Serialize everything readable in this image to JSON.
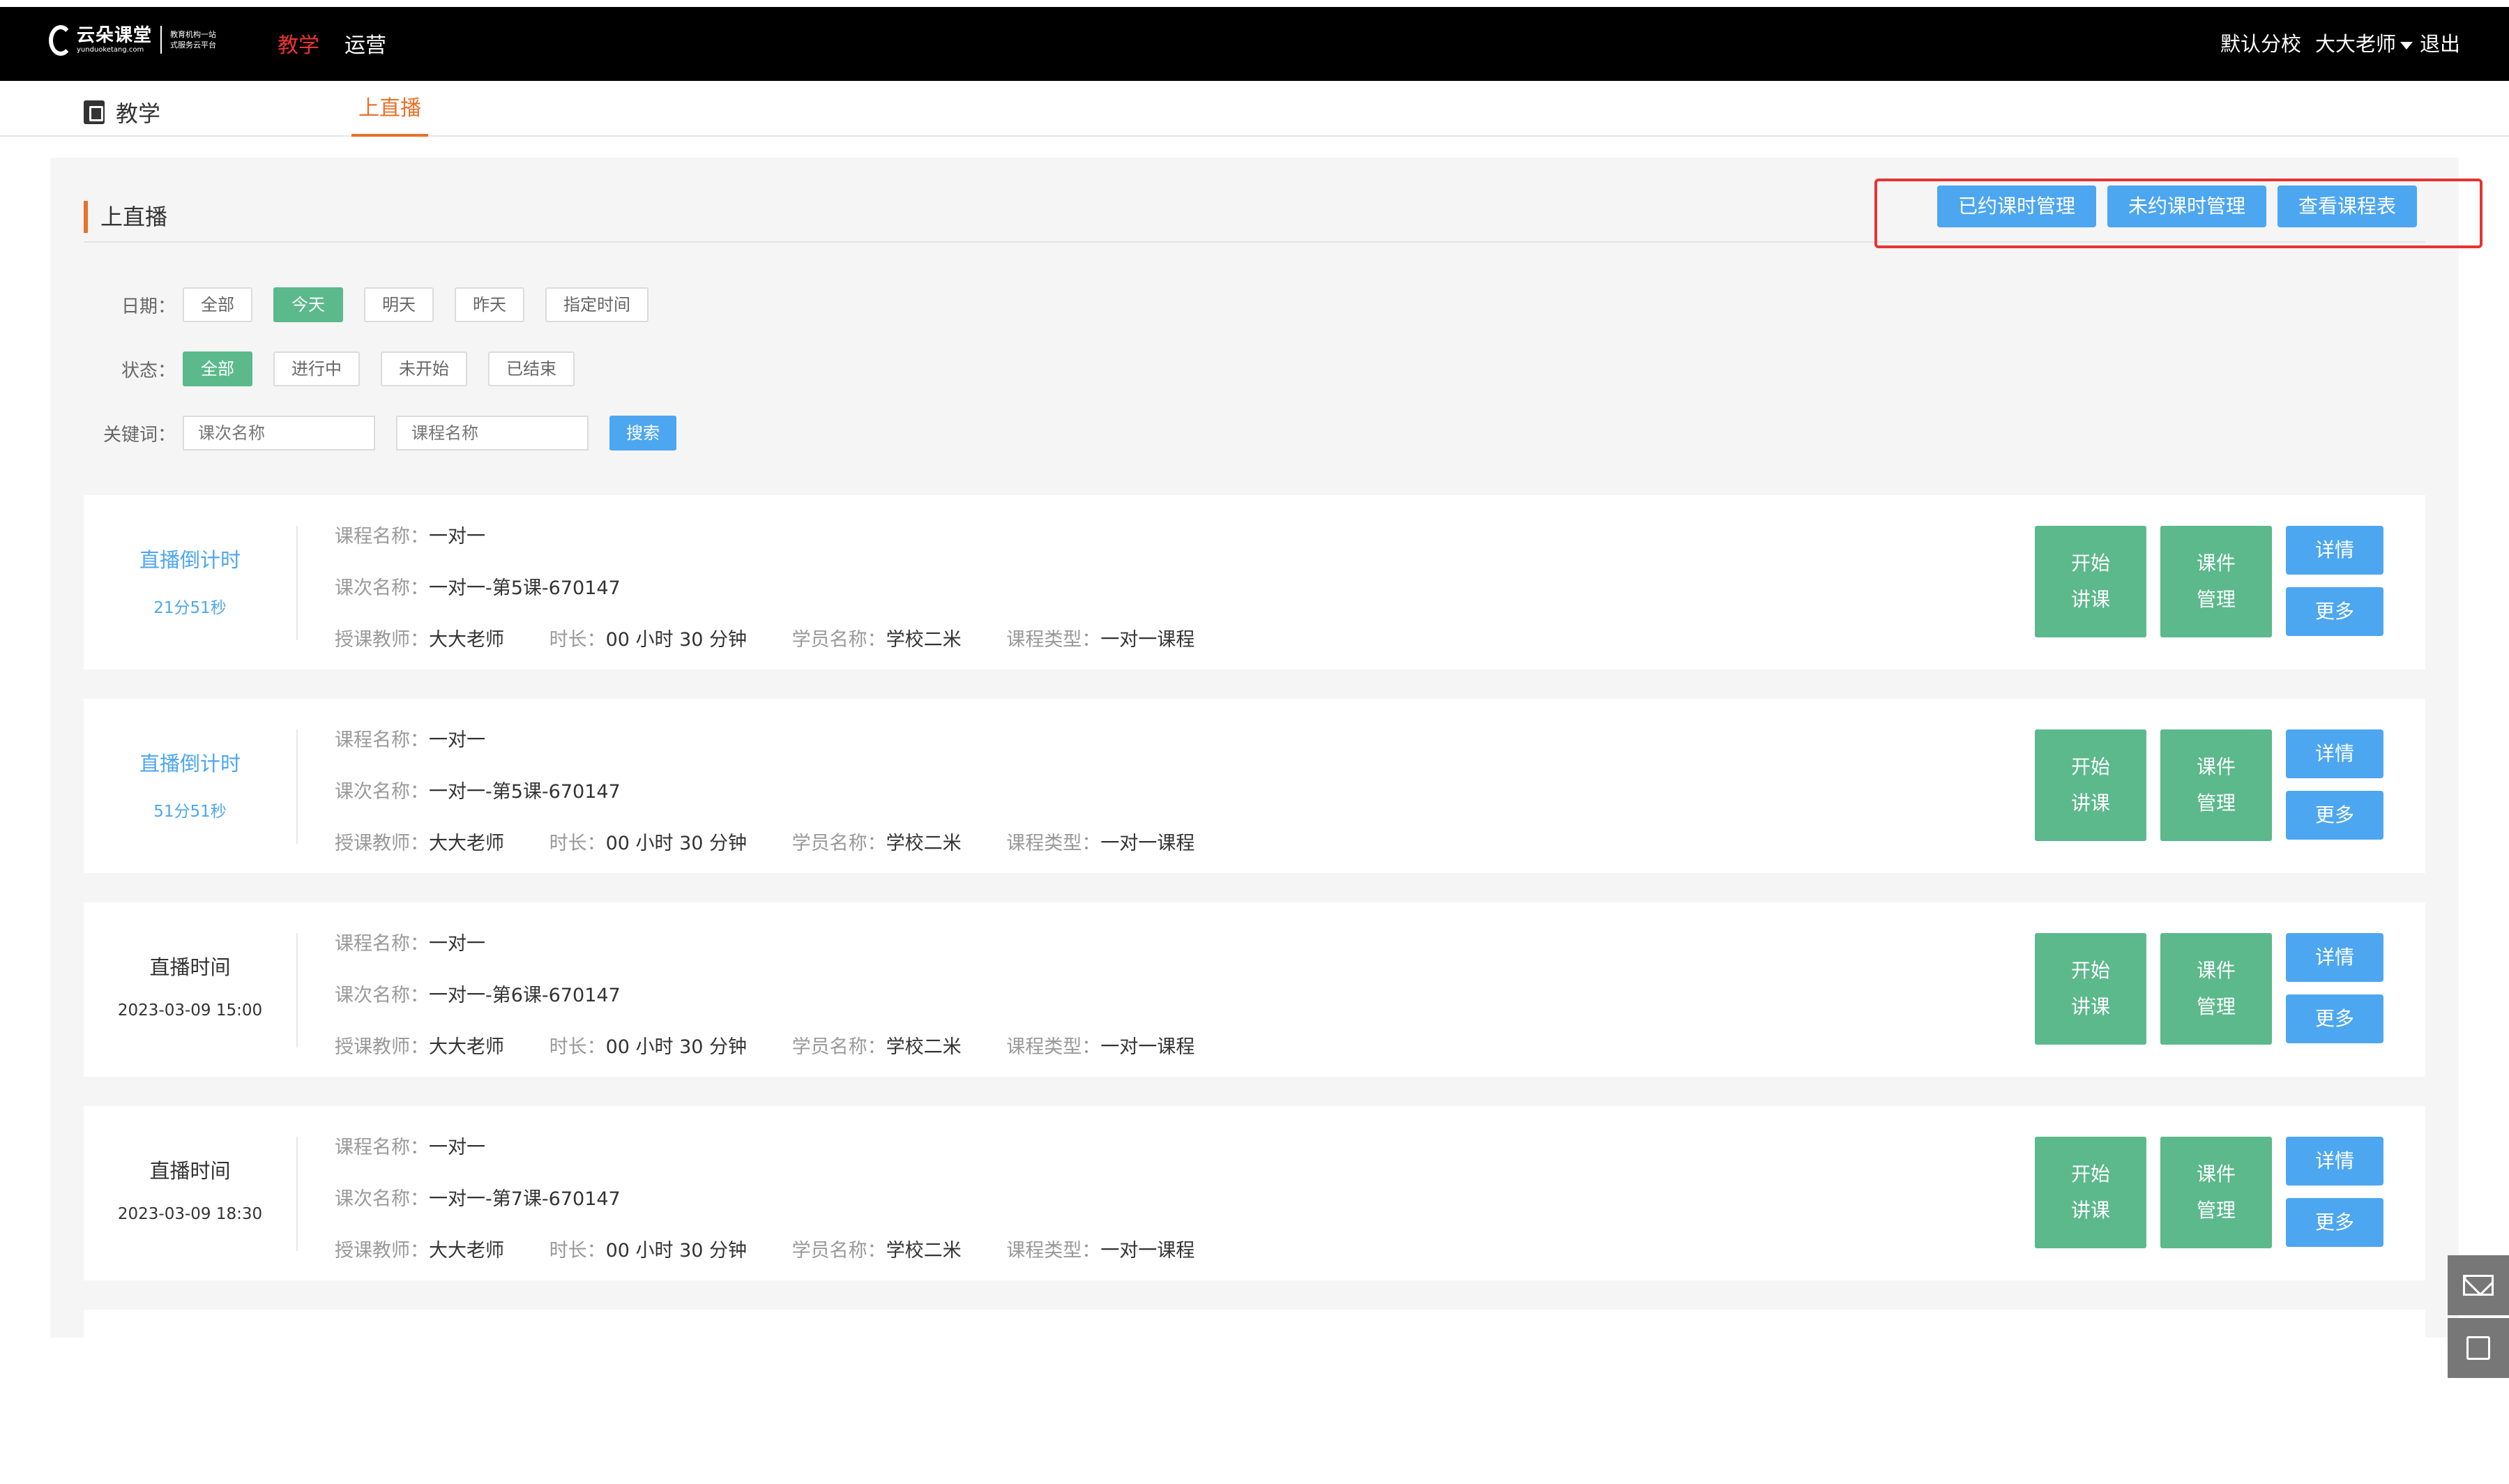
{
  "header": {
    "logo_text": "云朵课堂",
    "logo_en": "yunduoketang.com",
    "logo_slogan_1": "教育机构一站",
    "logo_slogan_2": "式服务云平台",
    "nav": [
      {
        "label": "教学",
        "active": true
      },
      {
        "label": "运营",
        "active": false
      }
    ],
    "branch": "默认分校",
    "user": "大大老师",
    "logout": "退出"
  },
  "subnav": {
    "brand": "教学",
    "tab": "上直播"
  },
  "section": {
    "title": "上直播",
    "actions": [
      "已约课时管理",
      "未约课时管理",
      "查看课程表"
    ]
  },
  "filters": {
    "date_label": "日期：",
    "date_options": [
      "全部",
      "今天",
      "明天",
      "昨天",
      "指定时间"
    ],
    "date_selected": "今天",
    "status_label": "状态：",
    "status_options": [
      "全部",
      "进行中",
      "未开始",
      "已结束"
    ],
    "status_selected": "全部",
    "keyword_label": "关键词：",
    "keyword_placeholder_1": "课次名称",
    "keyword_placeholder_2": "课程名称",
    "search_label": "搜索"
  },
  "labels": {
    "course_name": "课程名称：",
    "session_name": "课次名称：",
    "teacher": "授课教师：",
    "duration": "时长：",
    "student": "学员名称：",
    "course_type": "课程类型：",
    "start_1": "开始",
    "start_2": "讲课",
    "courseware_1": "课件",
    "courseware_2": "管理",
    "detail": "详情",
    "more": "更多"
  },
  "cards": [
    {
      "left_title": "直播倒计时",
      "left_sub": "21分51秒",
      "countdown": true,
      "course_name": "一对一",
      "session_name": "一对一-第5课-670147",
      "teacher": "大大老师",
      "duration": "00 小时 30 分钟",
      "student": "学校二米",
      "course_type": "一对一课程"
    },
    {
      "left_title": "直播倒计时",
      "left_sub": "51分51秒",
      "countdown": true,
      "course_name": "一对一",
      "session_name": "一对一-第5课-670147",
      "teacher": "大大老师",
      "duration": "00 小时 30 分钟",
      "student": "学校二米",
      "course_type": "一对一课程"
    },
    {
      "left_title": "直播时间",
      "left_sub": "2023-03-09 15:00",
      "countdown": false,
      "course_name": "一对一",
      "session_name": "一对一-第6课-670147",
      "teacher": "大大老师",
      "duration": "00 小时 30 分钟",
      "student": "学校二米",
      "course_type": "一对一课程"
    },
    {
      "left_title": "直播时间",
      "left_sub": "2023-03-09 18:30",
      "countdown": false,
      "course_name": "一对一",
      "session_name": "一对一-第7课-670147",
      "teacher": "大大老师",
      "duration": "00 小时 30 分钟",
      "student": "学校二米",
      "course_type": "一对一课程"
    }
  ],
  "float_tools": [
    "mail-icon",
    "edit-icon"
  ]
}
